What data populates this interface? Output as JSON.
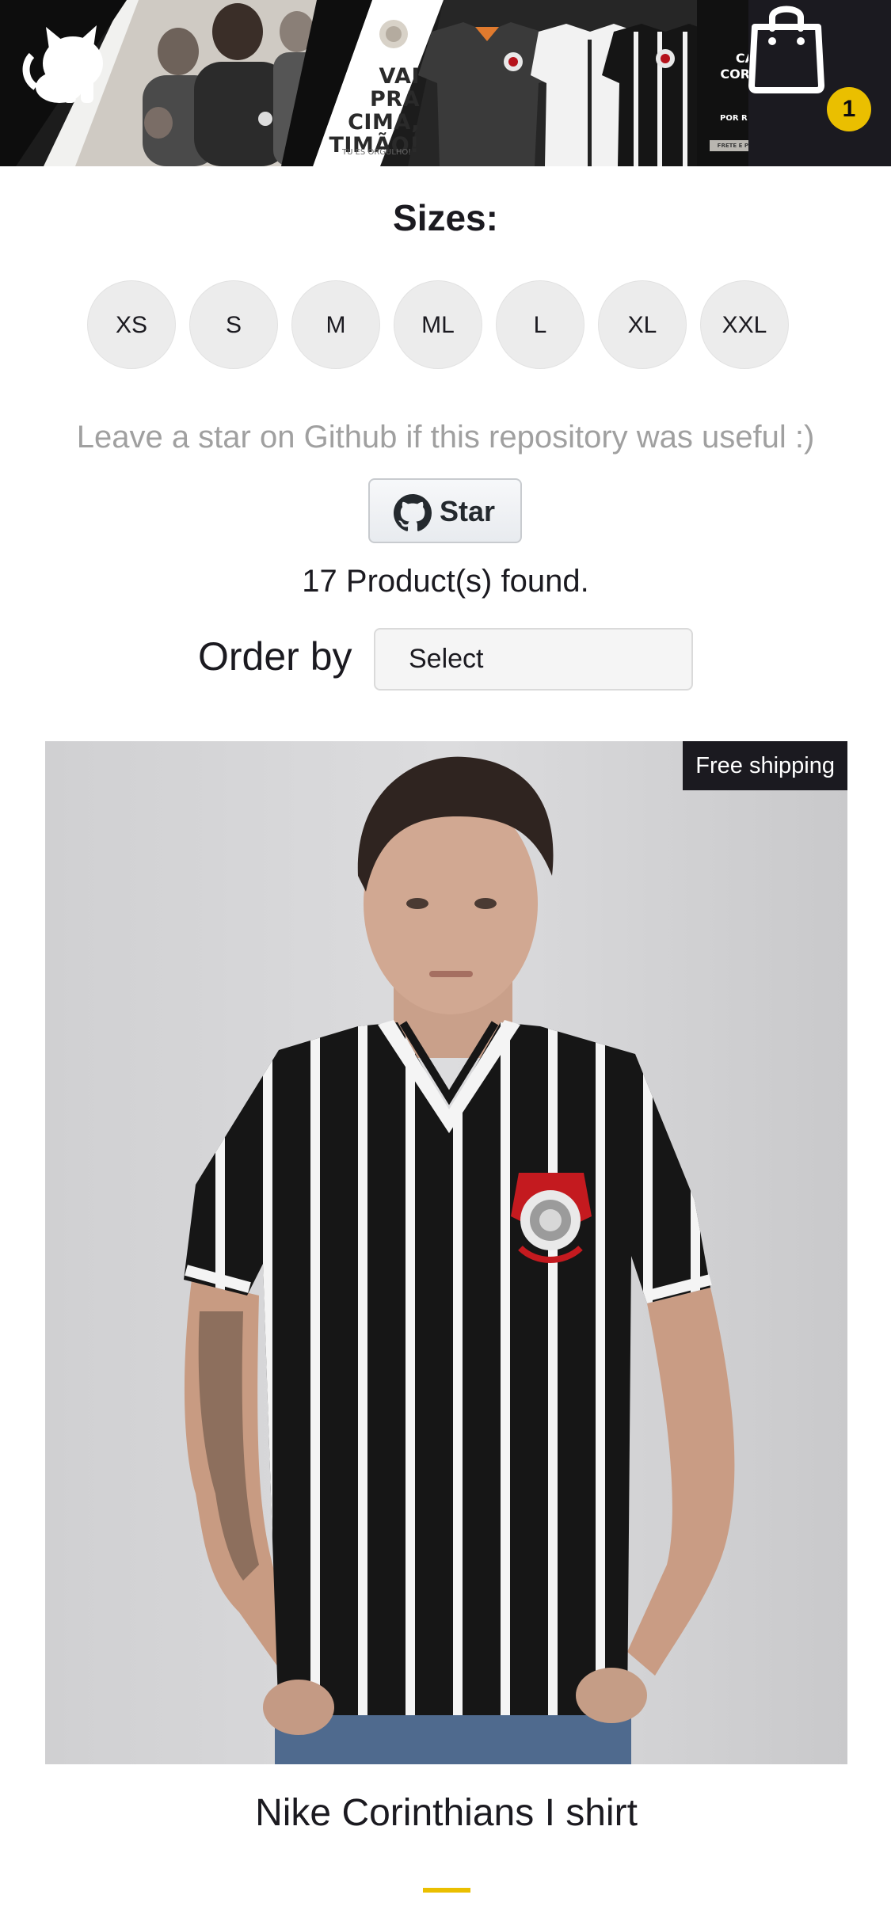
{
  "header": {
    "banner": {
      "heading_lines": [
        "VAI",
        "PRA",
        "CIMA,",
        "TIMÃO!"
      ],
      "tagline": "TU ES ORGULHO!",
      "side_lines": [
        "CA",
        "CORI",
        "I"
      ],
      "side_small": "POR R",
      "strip_text": "FRETE E PERSONALIZAÇÃO GRÁTIS"
    },
    "logo_icon": "octocat-icon",
    "cart": {
      "icon": "shopping-bag-icon",
      "count": "1"
    }
  },
  "filters": {
    "title": "Sizes:",
    "sizes": [
      "XS",
      "S",
      "M",
      "ML",
      "L",
      "XL",
      "XXL"
    ]
  },
  "star": {
    "message": "Leave a star on Github if this repository was useful :)",
    "button_label": "Star",
    "button_icon": "github-icon"
  },
  "shelf": {
    "products_found": "17 Product(s) found.",
    "order_label": "Order by",
    "order_selected": "Select"
  },
  "product": {
    "badge": "Free shipping",
    "title": "Nike Corinthians I shirt"
  },
  "colors": {
    "dark": "#1b1a20",
    "accent": "#eabf00",
    "chip": "#ececec",
    "muted_text": "#a0a0a0"
  }
}
